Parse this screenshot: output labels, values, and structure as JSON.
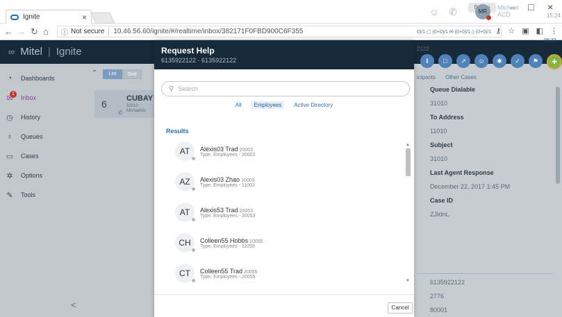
{
  "browser": {
    "tab_title": "Ignite",
    "tab_close": "×",
    "user_chip": "Benoe",
    "win_min": "–",
    "win_max": "□",
    "win_close": "×",
    "not_secure": "Not secure",
    "url": "10.46.56.60/ignite/#/realtime/inbox/382171F0FBD900C6F355"
  },
  "app": {
    "brand": "Mitel",
    "brand_sep": "|",
    "app_name": "Ignite",
    "nav": [
      {
        "label": "Dashboards",
        "icon": "dashboard-icon"
      },
      {
        "label": "Inbox",
        "icon": "inbox-icon",
        "badge": "1"
      },
      {
        "label": "History",
        "icon": "history-icon"
      },
      {
        "label": "Queues",
        "icon": "queues-icon"
      },
      {
        "label": "Cases",
        "icon": "cases-icon"
      },
      {
        "label": "Options",
        "icon": "options-icon"
      },
      {
        "label": "Tools",
        "icon": "tools-icon"
      }
    ],
    "collapse": "<",
    "inbox": {
      "toggle_list": "List",
      "toggle_grid": "Grid",
      "card": {
        "num": "6",
        "name": "CUBAY",
        "sub1": "31010",
        "sub2": "MichaelVo"
      }
    }
  },
  "header_right": {
    "avatar_initials": "MR",
    "user_name": "Michael",
    "user_status": "ACD",
    "time": "15:24"
  },
  "right_panel": {
    "stats": "0)/1  ▢ (0+0)/1  ✉ (0+0)/1  ▯ (0+0)/1",
    "time": "06:33",
    "number": "2122",
    "tabs": [
      "icipants",
      "Other Cases"
    ],
    "fields": [
      {
        "label": "Queue Dialable",
        "value": "31010"
      },
      {
        "label": "To Address",
        "value": "11010"
      },
      {
        "label": "Subject",
        "value": "31010"
      },
      {
        "label": "Last Agent Response",
        "value": "December 22, 2017 1:45 PM"
      },
      {
        "label": "Case ID",
        "value": "ZJIdnL"
      }
    ],
    "lower_values": [
      "6135922122",
      "2776",
      "80001"
    ]
  },
  "modal": {
    "title": "Request Help",
    "subtitle": "6135922122 · 6135922122",
    "search_placeholder": "Search",
    "filters": [
      "All",
      "Employees",
      "Active Directory"
    ],
    "results_label": "Results",
    "results": [
      {
        "initials": "AT",
        "name": "Alexis03 Trad",
        "ext": "20003",
        "type": "Type: Employees -  20003"
      },
      {
        "initials": "AZ",
        "name": "Alexis03 Zhao",
        "ext": "10003",
        "type": "Type: Employees -  11003"
      },
      {
        "initials": "AT",
        "name": "Alexis53 Trad",
        "ext": "20053",
        "type": "Type: Employees -  20053"
      },
      {
        "initials": "CH",
        "name": "Colleen55 Hobbs",
        "ext": "10055",
        "type": "Type: Employees -  11055"
      },
      {
        "initials": "CT",
        "name": "Colleen55 Trad",
        "ext": "20055",
        "type": "Type: Employees -  20055"
      }
    ],
    "cancel": "Cancel"
  }
}
